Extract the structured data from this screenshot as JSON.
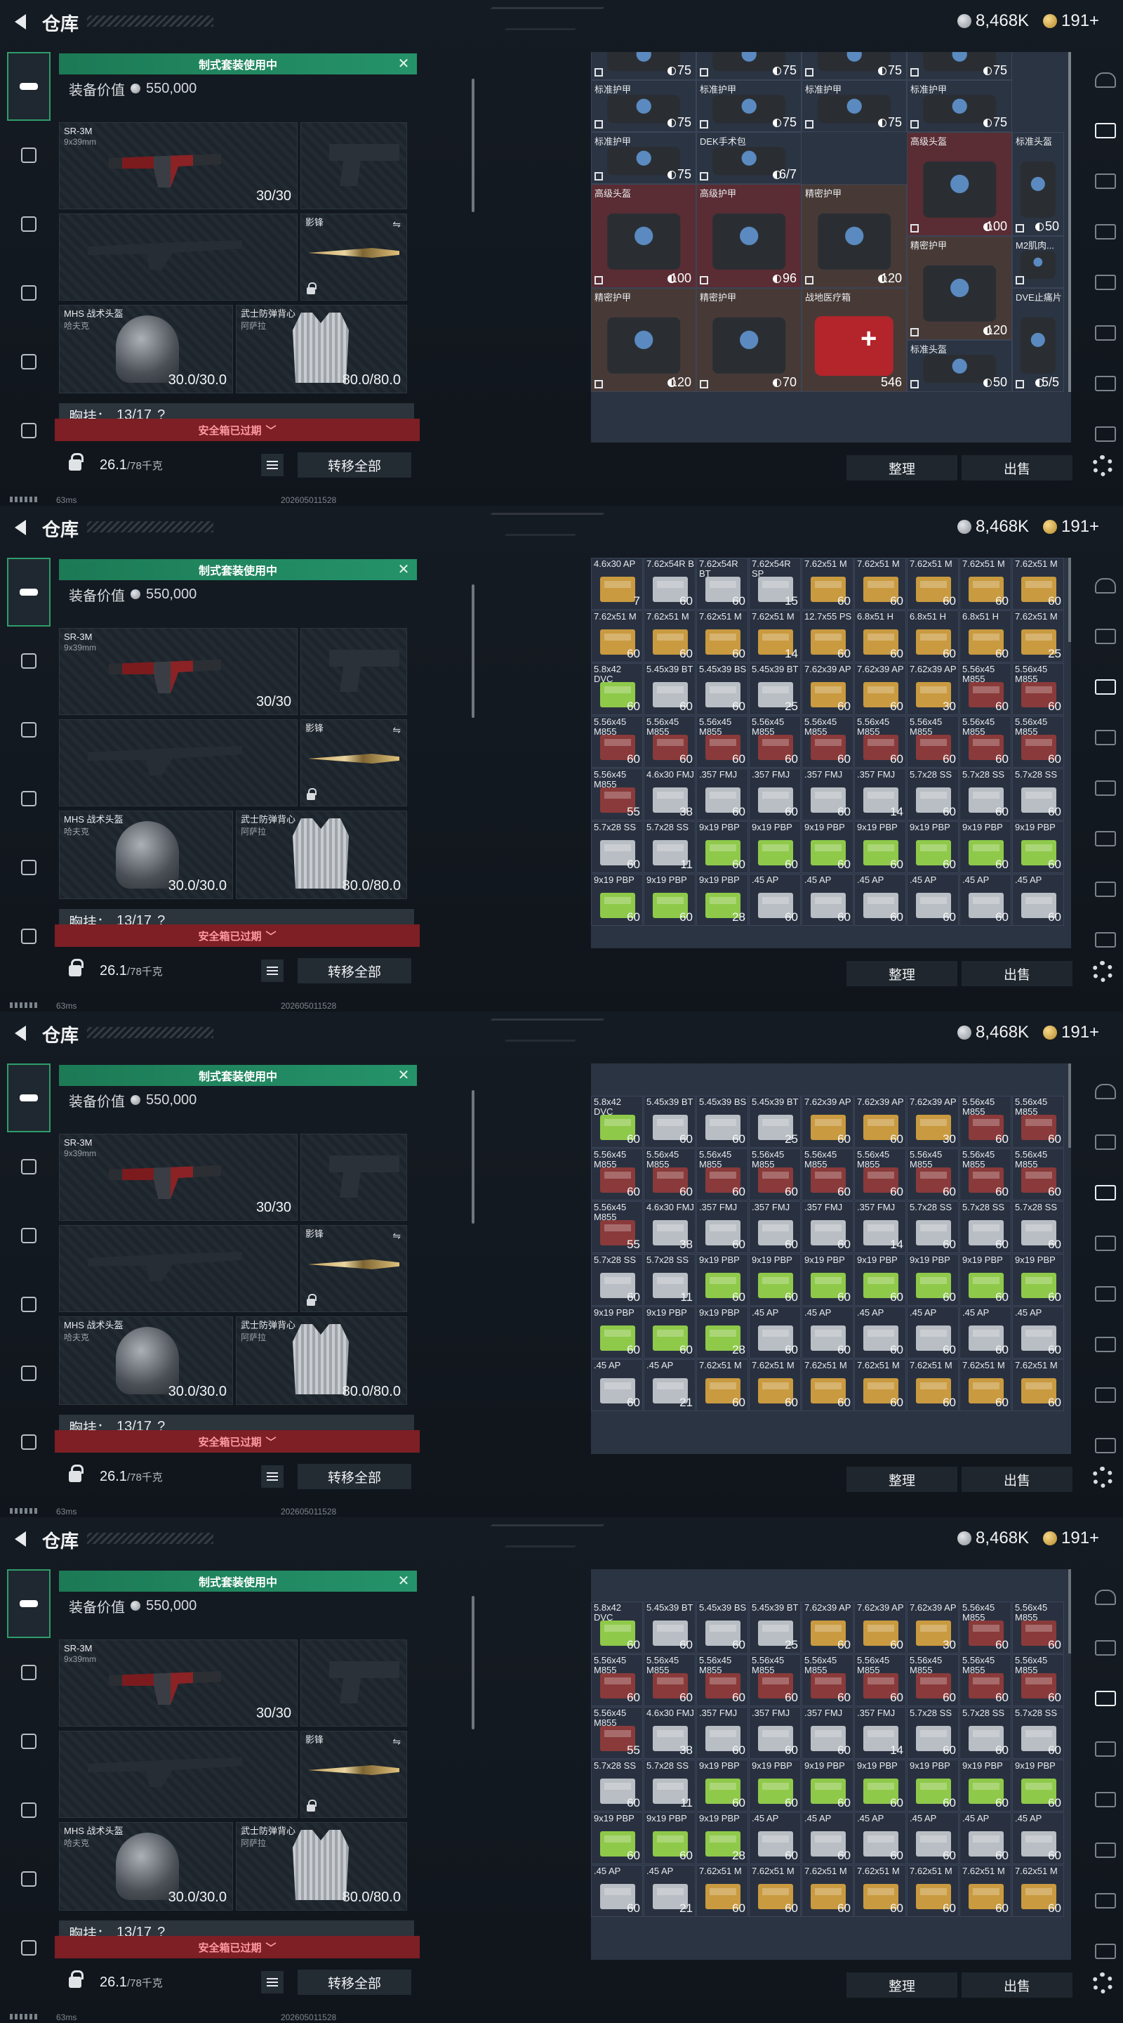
{
  "header": {
    "title": "仓库",
    "silver": "8,468K",
    "gold": "191+"
  },
  "equip": {
    "banner": "制式套装使用中",
    "value_label": "装备价值",
    "value": "550,000",
    "primary": {
      "name": "SR-3M",
      "sub": "9x39mm",
      "ammo": "30/30"
    },
    "melee": {
      "name": "影锋"
    },
    "helmet": {
      "name": "MHS 战术头盔",
      "sub": "哈夫克",
      "durability": "30.0/30.0"
    },
    "armor": {
      "name": "武士防弹背心",
      "sub": "阿萨拉",
      "durability": "80.0/80.0"
    },
    "chest_rig": {
      "label": "胸挂：",
      "value": "13/17",
      "help": "?"
    },
    "safe_box": "安全箱已过期",
    "weight": "26.1",
    "weight_cap": "/78千克",
    "transfer_all": "转移全部"
  },
  "stash": {
    "sort": "整理",
    "sell": "出售",
    "gear_top": [
      {
        "label": "",
        "value": "75"
      },
      {
        "label": "",
        "value": "75"
      },
      {
        "label": "",
        "value": "75"
      },
      {
        "label": "",
        "value": "75"
      }
    ],
    "gear_row2": [
      {
        "label": "标准护甲",
        "value": "75"
      },
      {
        "label": "标准护甲",
        "value": "75"
      },
      {
        "label": "标准护甲",
        "value": "75"
      },
      {
        "label": "标准护甲",
        "value": "75"
      }
    ],
    "gear_row3": [
      {
        "label": "标准护甲",
        "value": "75"
      },
      {
        "label": "DEK手术包",
        "value": "6/7"
      },
      {
        "label": "高级头盔",
        "value": "100"
      },
      {
        "label": "标准头盔",
        "value": "50"
      }
    ],
    "gear_row4": [
      {
        "label": "高级头盔",
        "value": "100"
      },
      {
        "label": "高级护甲",
        "value": "96"
      },
      {
        "label": "精密护甲",
        "value": "120"
      },
      {
        "label": "精密护甲",
        "value": "120"
      },
      {
        "label": "M2肌肉...",
        "value": ""
      }
    ],
    "gear_row5": [
      {
        "label": "精密护甲",
        "value": "120"
      },
      {
        "label": "精密护甲",
        "value": "70"
      },
      {
        "label": "战地医疗箱",
        "value": "546"
      },
      {
        "label": "标准头盔",
        "value": "50"
      },
      {
        "label": "DVE止痛片",
        "value": "5/5"
      }
    ],
    "ammo_frame2": [
      [
        "4.6x30 AP",
        "7",
        "gold"
      ],
      [
        "7.62x54R B",
        "60",
        "white"
      ],
      [
        "7.62x54R BT",
        "60",
        "white"
      ],
      [
        "7.62x54R SP",
        "15",
        "white"
      ],
      [
        "7.62x51 M",
        "60",
        "gold"
      ],
      [
        "7.62x51 M",
        "60",
        "gold"
      ],
      [
        "7.62x51 M",
        "60",
        "gold"
      ],
      [
        "7.62x51 M",
        "60",
        "gold"
      ],
      [
        "7.62x51 M",
        "60",
        "gold"
      ],
      [
        "7.62x51 M",
        "60",
        "gold"
      ],
      [
        "7.62x51 M",
        "60",
        "gold"
      ],
      [
        "7.62x51 M",
        "60",
        "gold"
      ],
      [
        "7.62x51 M",
        "14",
        "gold"
      ],
      [
        "12.7x55 PS",
        "60",
        "gold"
      ],
      [
        "6.8x51 H",
        "60",
        "gold"
      ],
      [
        "6.8x51 H",
        "60",
        "gold"
      ],
      [
        "6.8x51 H",
        "60",
        "gold"
      ],
      [
        "7.62x51 M",
        "25",
        "gold"
      ],
      [
        "5.8x42 DVC",
        "60",
        "green"
      ],
      [
        "5.45x39 BT",
        "60",
        "white"
      ],
      [
        "5.45x39 BS",
        "60",
        "white"
      ],
      [
        "5.45x39 BT",
        "25",
        "white"
      ],
      [
        "7.62x39 AP",
        "60",
        "gold"
      ],
      [
        "7.62x39 AP",
        "60",
        "gold"
      ],
      [
        "7.62x39 AP",
        "30",
        "gold"
      ],
      [
        "5.56x45 M855",
        "60",
        "red"
      ],
      [
        "5.56x45 M855",
        "60",
        "red"
      ],
      [
        "5.56x45 M855",
        "60",
        "red"
      ],
      [
        "5.56x45 M855",
        "60",
        "red"
      ],
      [
        "5.56x45 M855",
        "60",
        "red"
      ],
      [
        "5.56x45 M855",
        "60",
        "red"
      ],
      [
        "5.56x45 M855",
        "60",
        "red"
      ],
      [
        "5.56x45 M855",
        "60",
        "red"
      ],
      [
        "5.56x45 M855",
        "60",
        "red"
      ],
      [
        "5.56x45 M855",
        "60",
        "red"
      ],
      [
        "5.56x45 M855",
        "60",
        "red"
      ],
      [
        "5.56x45 M855",
        "55",
        "red"
      ],
      [
        "4.6x30 FMJ",
        "38",
        "white"
      ],
      [
        ".357 FMJ",
        "60",
        "white"
      ],
      [
        ".357 FMJ",
        "60",
        "white"
      ],
      [
        ".357 FMJ",
        "60",
        "white"
      ],
      [
        ".357 FMJ",
        "14",
        "white"
      ],
      [
        "5.7x28 SS",
        "60",
        "white"
      ],
      [
        "5.7x28 SS",
        "60",
        "white"
      ],
      [
        "5.7x28 SS",
        "60",
        "white"
      ],
      [
        "5.7x28 SS",
        "60",
        "white"
      ],
      [
        "5.7x28 SS",
        "11",
        "white"
      ],
      [
        "9x19 PBP",
        "60",
        "green"
      ],
      [
        "9x19 PBP",
        "60",
        "green"
      ],
      [
        "9x19 PBP",
        "60",
        "green"
      ],
      [
        "9x19 PBP",
        "60",
        "green"
      ],
      [
        "9x19 PBP",
        "60",
        "green"
      ],
      [
        "9x19 PBP",
        "60",
        "green"
      ],
      [
        "9x19 PBP",
        "60",
        "green"
      ],
      [
        "9x19 PBP",
        "60",
        "green"
      ],
      [
        "9x19 PBP",
        "60",
        "green"
      ],
      [
        "9x19 PBP",
        "28",
        "green"
      ],
      [
        ".45 AP",
        "60",
        "white"
      ],
      [
        ".45 AP",
        "60",
        "white"
      ],
      [
        ".45 AP",
        "60",
        "white"
      ],
      [
        ".45 AP",
        "60",
        "white"
      ],
      [
        ".45 AP",
        "60",
        "white"
      ],
      [
        ".45 AP",
        "60",
        "white"
      ]
    ],
    "ammo_frame3": [
      [
        "5.8x42 DVC",
        "60",
        "green"
      ],
      [
        "5.45x39 BT",
        "60",
        "white"
      ],
      [
        "5.45x39 BS",
        "60",
        "white"
      ],
      [
        "5.45x39 BT",
        "25",
        "white"
      ],
      [
        "7.62x39 AP",
        "60",
        "gold"
      ],
      [
        "7.62x39 AP",
        "60",
        "gold"
      ],
      [
        "7.62x39 AP",
        "30",
        "gold"
      ],
      [
        "5.56x45 M855",
        "60",
        "red"
      ],
      [
        "5.56x45 M855",
        "60",
        "red"
      ],
      [
        "5.56x45 M855",
        "60",
        "red"
      ],
      [
        "5.56x45 M855",
        "60",
        "red"
      ],
      [
        "5.56x45 M855",
        "60",
        "red"
      ],
      [
        "5.56x45 M855",
        "60",
        "red"
      ],
      [
        "5.56x45 M855",
        "60",
        "red"
      ],
      [
        "5.56x45 M855",
        "60",
        "red"
      ],
      [
        "5.56x45 M855",
        "60",
        "red"
      ],
      [
        "5.56x45 M855",
        "60",
        "red"
      ],
      [
        "5.56x45 M855",
        "60",
        "red"
      ],
      [
        "5.56x45 M855",
        "55",
        "red"
      ],
      [
        "4.6x30 FMJ",
        "38",
        "white"
      ],
      [
        ".357 FMJ",
        "60",
        "white"
      ],
      [
        ".357 FMJ",
        "60",
        "white"
      ],
      [
        ".357 FMJ",
        "60",
        "white"
      ],
      [
        ".357 FMJ",
        "14",
        "white"
      ],
      [
        "5.7x28 SS",
        "60",
        "white"
      ],
      [
        "5.7x28 SS",
        "60",
        "white"
      ],
      [
        "5.7x28 SS",
        "60",
        "white"
      ],
      [
        "5.7x28 SS",
        "60",
        "white"
      ],
      [
        "5.7x28 SS",
        "11",
        "white"
      ],
      [
        "9x19 PBP",
        "60",
        "green"
      ],
      [
        "9x19 PBP",
        "60",
        "green"
      ],
      [
        "9x19 PBP",
        "60",
        "green"
      ],
      [
        "9x19 PBP",
        "60",
        "green"
      ],
      [
        "9x19 PBP",
        "60",
        "green"
      ],
      [
        "9x19 PBP",
        "60",
        "green"
      ],
      [
        "9x19 PBP",
        "60",
        "green"
      ],
      [
        "9x19 PBP",
        "60",
        "green"
      ],
      [
        "9x19 PBP",
        "60",
        "green"
      ],
      [
        "9x19 PBP",
        "28",
        "green"
      ],
      [
        ".45 AP",
        "60",
        "white"
      ],
      [
        ".45 AP",
        "60",
        "white"
      ],
      [
        ".45 AP",
        "60",
        "white"
      ],
      [
        ".45 AP",
        "60",
        "white"
      ],
      [
        ".45 AP",
        "60",
        "white"
      ],
      [
        ".45 AP",
        "60",
        "white"
      ],
      [
        ".45 AP",
        "60",
        "white"
      ],
      [
        ".45 AP",
        "21",
        "white"
      ],
      [
        "7.62x51 M",
        "60",
        "gold"
      ],
      [
        "7.62x51 M",
        "60",
        "gold"
      ],
      [
        "7.62x51 M",
        "60",
        "gold"
      ],
      [
        "7.62x51 M",
        "60",
        "gold"
      ],
      [
        "7.62x51 M",
        "60",
        "gold"
      ],
      [
        "7.62x51 M",
        "60",
        "gold"
      ],
      [
        "7.62x51 M",
        "60",
        "gold"
      ]
    ]
  },
  "status": {
    "ping": "63ms",
    "build": "202605011528"
  },
  "colors": {
    "green": "#25936a",
    "red": "#7d1f24",
    "accent": "#2f9d6b"
  }
}
